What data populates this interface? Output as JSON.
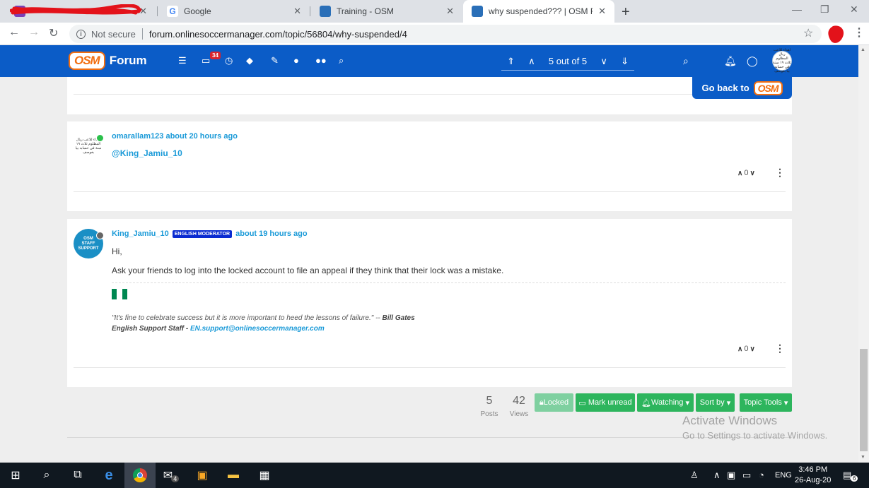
{
  "browser": {
    "tabs": [
      {
        "title": "",
        "favicon_color": "#7b3fb5"
      },
      {
        "title": "Google",
        "favicon_color": "#4285f4"
      },
      {
        "title": "Training - OSM",
        "favicon_color": "#2a6fb8"
      },
      {
        "title": "why suspended??? | OSM Forum",
        "favicon_color": "#2a6fb8"
      }
    ],
    "security_label": "Not secure",
    "url": "forum.onlinesoccermanager.com/topic/56804/why-suspended/4"
  },
  "forum_header": {
    "logo_text": "OSM",
    "forum_label": "Forum",
    "notification_count": "34",
    "pager_text": "5 out of 5"
  },
  "go_back": {
    "label": "Go back to",
    "logo_text": "OSM"
  },
  "posts": [
    {
      "author": "omarallam123",
      "time": "about 20 hours ago",
      "avatar_text": "اهداء للاعب ريال المظلوم ثلاث ١٩ سنة في حسابه بيا بغوصف",
      "status_color": "#2bc04b",
      "body_mention": "@King_Jamiu_10",
      "votes": "0"
    },
    {
      "author": "King_Jamiu_10",
      "badge": "ENGLISH MODERATOR",
      "time": "about 19 hours ago",
      "avatar_text": "OSM STAFF SUPPORT",
      "status_color": "#666666",
      "greeting": "Hi,",
      "body": "Ask your friends to log into the locked account to file an appeal if they think that their lock was a mistake.",
      "signature_quote": "\"It's fine to celebrate success but it is more important to heed the lessons of failure.\" --",
      "signature_quote_author": "Bill Gates",
      "signature_role": "English Support Staff -",
      "signature_email": "EN.support@onlinesoccermanager.com",
      "votes": "0"
    }
  ],
  "topic_stats": {
    "posts_count": "5",
    "posts_label": "Posts",
    "views_count": "42",
    "views_label": "Views"
  },
  "topic_buttons": {
    "locked": "Locked",
    "mark_unread": "Mark unread",
    "watching": "Watching",
    "sort_by": "Sort by",
    "topic_tools": "Topic Tools"
  },
  "watermark": {
    "line1": "Activate Windows",
    "line2": "Go to Settings to activate Windows."
  },
  "taskbar": {
    "mail_count": "4",
    "language": "ENG",
    "time": "3:46 PM",
    "date": "26-Aug-20",
    "notification_count": "6"
  },
  "colors": {
    "osm_blue": "#0b5cc7",
    "link_blue": "#1a9ad8",
    "button_green": "#2db55d",
    "osm_orange": "#f26e10"
  }
}
